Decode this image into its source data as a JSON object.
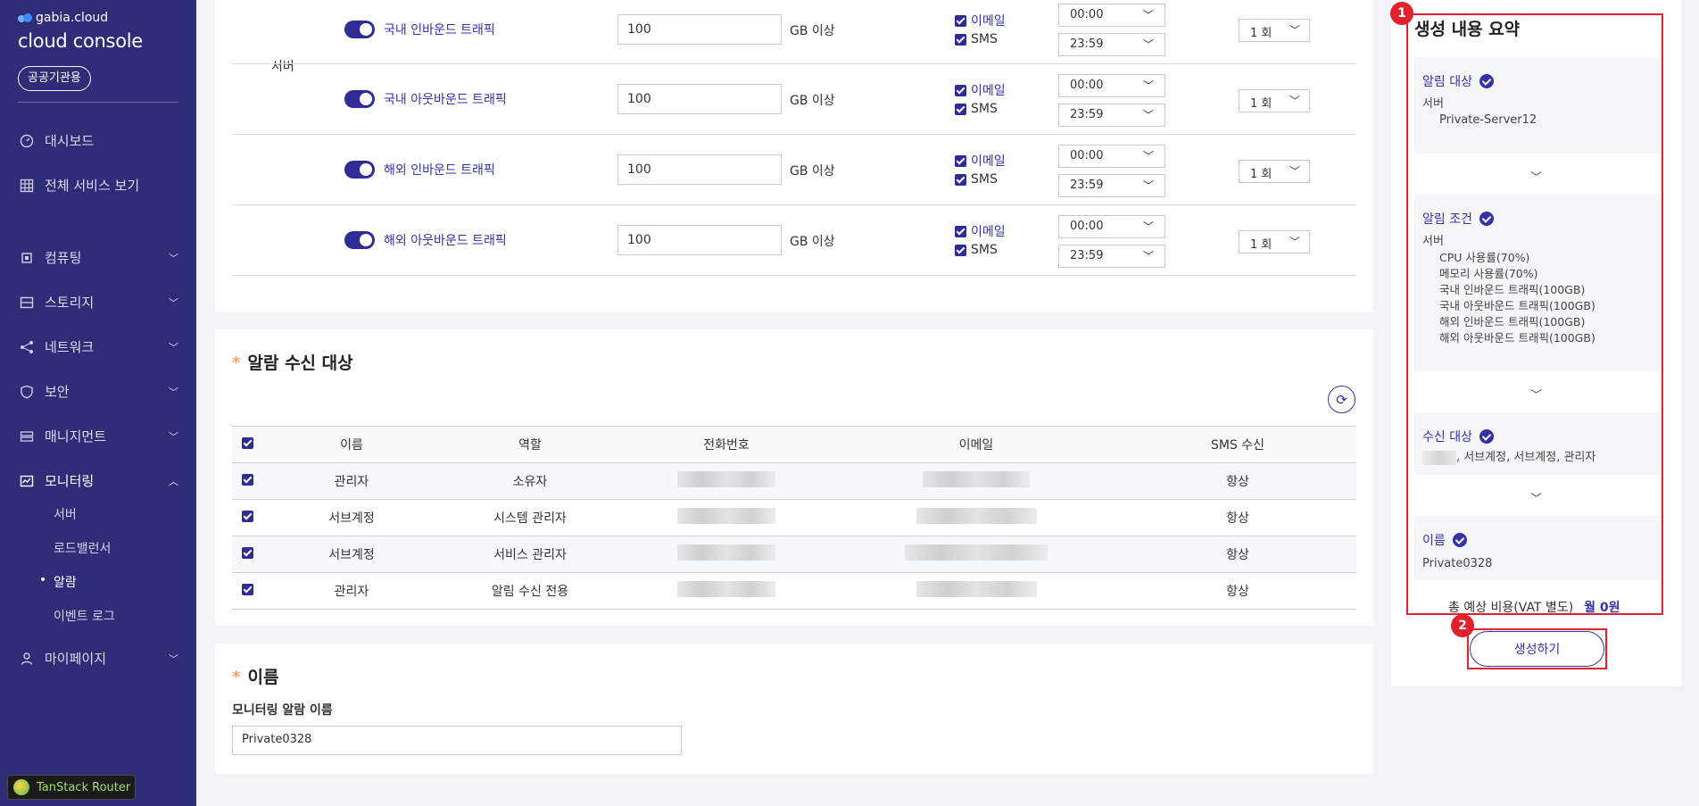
{
  "sidebar": {
    "brand_small": "gabia.cloud",
    "brand_main": "cloud console",
    "badge": "공공기관용",
    "items": [
      {
        "label": "대시보드"
      },
      {
        "label": "전체 서비스 보기"
      },
      {
        "label": "컴퓨팅"
      },
      {
        "label": "스토리지"
      },
      {
        "label": "네트워크"
      },
      {
        "label": "보안"
      },
      {
        "label": "매니지먼트"
      },
      {
        "label": "모니터링"
      },
      {
        "label": "마이페이지"
      }
    ],
    "monitoring_sub": [
      {
        "label": "서버"
      },
      {
        "label": "로드밸런서"
      },
      {
        "label": "알람"
      },
      {
        "label": "이벤트 로그"
      }
    ],
    "router_badge": "TanStack Router"
  },
  "traffic": {
    "group_label": "서버",
    "unit": "GB 이상",
    "email_label": "이메일",
    "sms_label": "SMS",
    "rows": [
      {
        "name": "국내 인바운드 트래픽",
        "value": "100",
        "start": "00:00",
        "end": "23:59",
        "count": "1 회"
      },
      {
        "name": "국내 아웃바운드 트래픽",
        "value": "100",
        "start": "00:00",
        "end": "23:59",
        "count": "1 회"
      },
      {
        "name": "해외 인바운드 트래픽",
        "value": "100",
        "start": "00:00",
        "end": "23:59",
        "count": "1 회"
      },
      {
        "name": "해외 아웃바운드 트래픽",
        "value": "100",
        "start": "00:00",
        "end": "23:59",
        "count": "1 회"
      }
    ]
  },
  "recipients": {
    "title": "알람 수신 대상",
    "required_mark": "*",
    "headers": [
      "이름",
      "역할",
      "전화번호",
      "이메일",
      "SMS 수신"
    ],
    "rows": [
      {
        "name": "관리자",
        "role": "소유자",
        "sms": "항상"
      },
      {
        "name": "서브계정",
        "role": "시스템 관리자",
        "sms": "항상"
      },
      {
        "name": "서브계정",
        "role": "서비스 관리자",
        "sms": "항상"
      },
      {
        "name": "관리자",
        "role": "알림 수신 전용",
        "sms": "항상"
      }
    ]
  },
  "name_section": {
    "title": "이름",
    "required_mark": "*",
    "field_label": "모니터링 알람 이름",
    "value": "Private0328"
  },
  "summary": {
    "title": "생성 내용 요약",
    "target_head": "알림 대상",
    "target_type": "서버",
    "target_value": "Private-Server12",
    "cond_head": "알림 조건",
    "cond_type": "서버",
    "conditions": [
      "CPU 사용률(70%)",
      "메모리 사용률(70%)",
      "국내 인바운드 트래픽(100GB)",
      "국내 아웃바운드 트래픽(100GB)",
      "해외 인바운드 트래픽(100GB)",
      "해외 아웃바운드 트래픽(100GB)"
    ],
    "recv_head": "수신 대상",
    "recv_value": ", 서브계정, 서브계정, 관리자",
    "name_head": "이름",
    "name_value": "Private0328",
    "cost_label": "총 예상 비용(VAT 별도)",
    "cost_value": "월 0원",
    "create_label": "생성하기"
  },
  "annotations": {
    "marker1": "1",
    "marker2": "2"
  }
}
